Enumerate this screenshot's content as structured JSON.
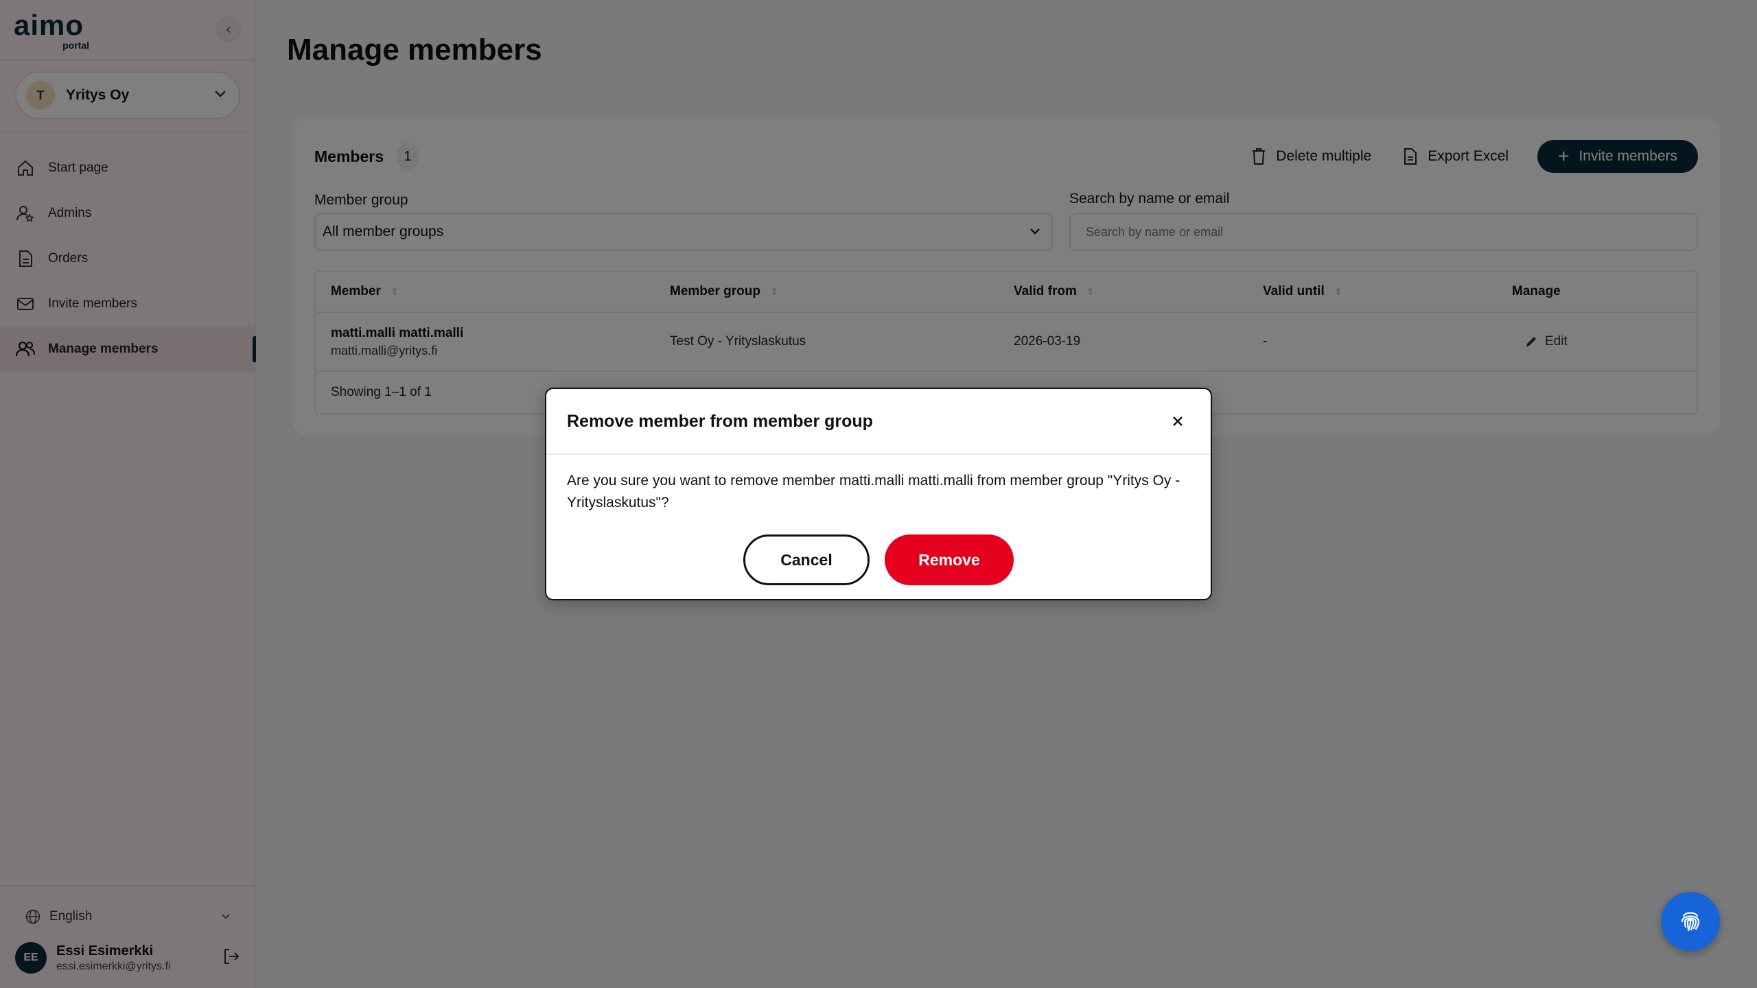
{
  "brand": {
    "name": "aimo",
    "sub": "portal"
  },
  "org": {
    "initial": "T",
    "name": "Yritys Oy"
  },
  "nav": [
    {
      "label": "Start page",
      "icon": "home-icon"
    },
    {
      "label": "Admins",
      "icon": "admin-user-icon"
    },
    {
      "label": "Orders",
      "icon": "document-icon"
    },
    {
      "label": "Invite members",
      "icon": "mail-icon"
    },
    {
      "label": "Manage members",
      "icon": "users-icon",
      "active": true
    }
  ],
  "language": "English",
  "user": {
    "initials": "EE",
    "name": "Essi Esimerkki",
    "email": "essi.esimerkki@yritys.fi"
  },
  "page": {
    "title": "Manage members"
  },
  "members_card": {
    "title": "Members",
    "count": "1",
    "delete_multiple": "Delete multiple",
    "export_excel": "Export Excel",
    "invite_members": "Invite members",
    "member_group_label": "Member group",
    "member_group_value": "All member groups",
    "search_label": "Search by name or email",
    "search_placeholder": "Search by name or email"
  },
  "table": {
    "headers": {
      "member": "Member",
      "member_group": "Member group",
      "valid_from": "Valid from",
      "valid_until": "Valid until",
      "manage": "Manage"
    },
    "rows": [
      {
        "name": "matti.malli matti.malli",
        "email": "matti.malli@yritys.fi",
        "group": "Test Oy - Yrityslaskutus",
        "valid_from": "2026-03-19",
        "valid_until": "-",
        "action": "Edit"
      }
    ],
    "footer": "Showing 1–1 of 1"
  },
  "modal": {
    "title": "Remove member from member group",
    "body": "Are you sure you want to remove member matti.malli matti.malli from member group \"Yritys Oy - Yrityslaskutus\"?",
    "cancel": "Cancel",
    "remove": "Remove"
  },
  "colors": {
    "brand_dark": "#0a2b3a",
    "danger": "#e4001e",
    "fab": "#1565d8",
    "sidebar_bg": "#fbeef3"
  }
}
